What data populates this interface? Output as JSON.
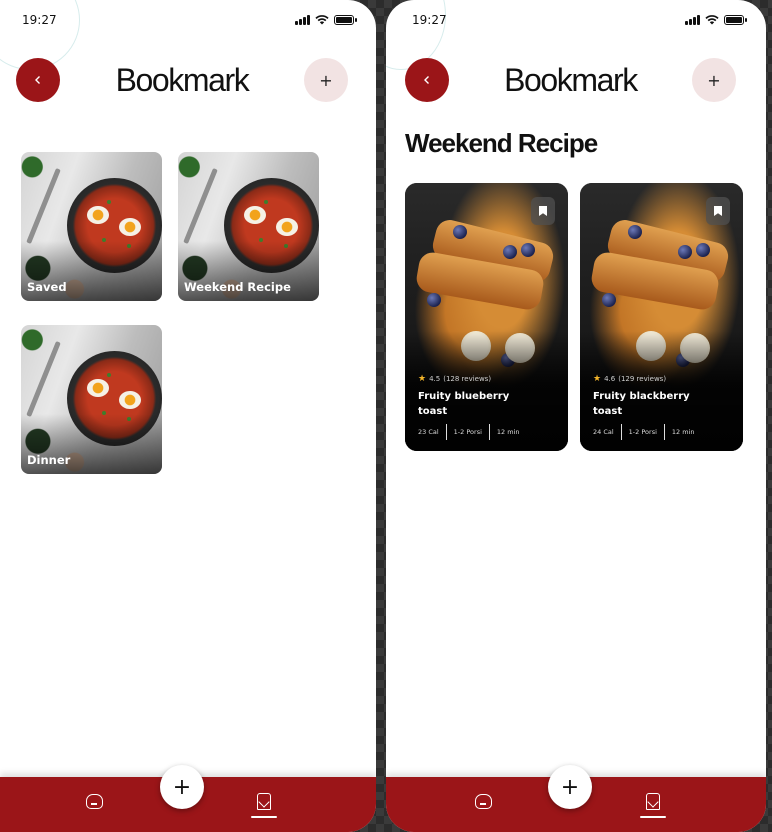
{
  "colors": {
    "brand": "#9b1518",
    "add_button_bg": "#f2e3e3",
    "star": "#f4b52a"
  },
  "status": {
    "time": "19:27"
  },
  "left_screen": {
    "title": "Bookmark",
    "back_icon": "chevron-left-icon",
    "add_label": "+",
    "folders": [
      {
        "label": "Saved"
      },
      {
        "label": "Weekend Recipe"
      },
      {
        "label": "Dinner"
      }
    ]
  },
  "right_screen": {
    "title": "Bookmark",
    "back_icon": "chevron-left-icon",
    "add_label": "+",
    "section_title": "Weekend Recipe",
    "recipes": [
      {
        "rating": "4.5",
        "reviews": "(128 reviews)",
        "name": "Fruity blueberry toast",
        "cal": "23 Cal",
        "portion": "1-2 Porsi",
        "time": "12 min",
        "icon": "bookmark-icon"
      },
      {
        "rating": "4.6",
        "reviews": "(129 reviews)",
        "name": "Fruity blackberry toast",
        "cal": "24 Cal",
        "portion": "1-2 Porsi",
        "time": "12 min",
        "icon": "bookmark-icon"
      }
    ]
  },
  "nav": {
    "fab_label": "+",
    "items": [
      {
        "icon": "home-icon"
      },
      {
        "icon": "bookmark-icon",
        "active": true
      }
    ]
  }
}
